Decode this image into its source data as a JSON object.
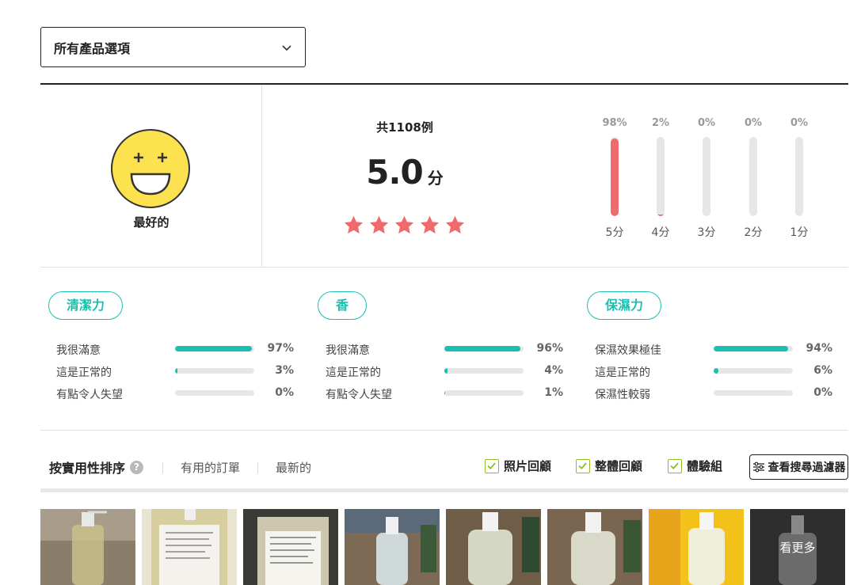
{
  "option_select": {
    "label": "所有產品選項"
  },
  "summary": {
    "face_label": "最好的",
    "count": "共1108例",
    "score": "5.0",
    "score_unit": "分",
    "stars": 5,
    "distribution": [
      {
        "pct": "98%",
        "label": "5分",
        "value": 98
      },
      {
        "pct": "2%",
        "label": "4分",
        "value": 2
      },
      {
        "pct": "0%",
        "label": "3分",
        "value": 0
      },
      {
        "pct": "0%",
        "label": "2分",
        "value": 0
      },
      {
        "pct": "0%",
        "label": "1分",
        "value": 0
      }
    ]
  },
  "features": [
    {
      "title": "清潔力",
      "rows": [
        {
          "label": "我很滿意",
          "pct": "97%",
          "value": 97
        },
        {
          "label": "這是正常的",
          "pct": "3%",
          "value": 3
        },
        {
          "label": "有點令人失望",
          "pct": "0%",
          "value": 0
        }
      ]
    },
    {
      "title": "香",
      "rows": [
        {
          "label": "我很滿意",
          "pct": "96%",
          "value": 96
        },
        {
          "label": "這是正常的",
          "pct": "4%",
          "value": 4
        },
        {
          "label": "有點令人失望",
          "pct": "1%",
          "value": 1
        }
      ]
    },
    {
      "title": "保濕力",
      "rows": [
        {
          "label": "保濕效果極佳",
          "pct": "94%",
          "value": 94
        },
        {
          "label": "這是正常的",
          "pct": "6%",
          "value": 6
        },
        {
          "label": "保濕性較弱",
          "pct": "0%",
          "value": 0
        }
      ]
    }
  ],
  "sort": {
    "main": "按實用性排序",
    "help": "?",
    "options": [
      "有用的訂單",
      "最新的"
    ],
    "checks": [
      "照片回顧",
      "整體回顧",
      "體驗組"
    ],
    "filter_button": "查看搜尋過濾器"
  },
  "colors": {
    "accent_red": "#ef6b6b",
    "teal": "#19c0b0",
    "check_green": "#8cbf26",
    "face_yellow": "#fde24f"
  },
  "thumbs": {
    "more_label": "看更多"
  }
}
